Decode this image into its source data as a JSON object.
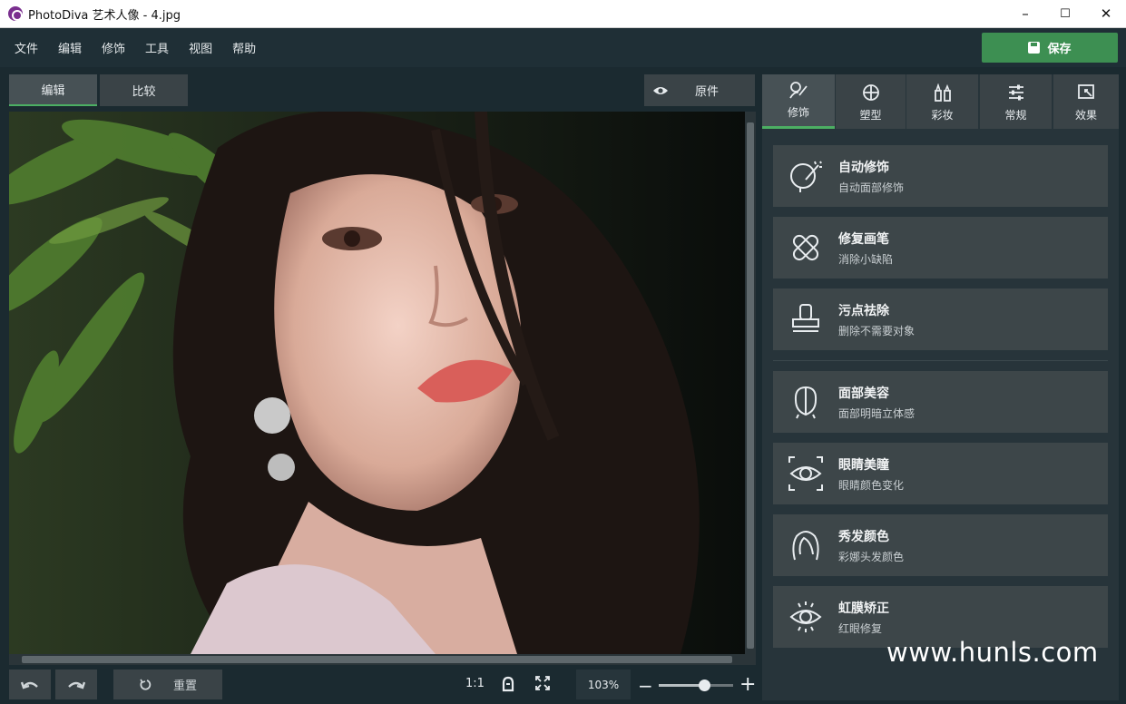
{
  "window": {
    "title": "PhotoDiva 艺术人像 - 4.jpg",
    "minimize": "–",
    "maximize": "☐",
    "close": "✕"
  },
  "menu": {
    "items": [
      "文件",
      "编辑",
      "修饰",
      "工具",
      "视图",
      "帮助"
    ],
    "save_label": "保存"
  },
  "view_tabs": {
    "edit": "编辑",
    "compare": "比较",
    "original": "原件"
  },
  "tool_tabs": [
    {
      "label": "修饰",
      "icon": "retouch-icon",
      "active": true
    },
    {
      "label": "塑型",
      "icon": "reshape-icon",
      "active": false
    },
    {
      "label": "彩妆",
      "icon": "makeup-icon",
      "active": false
    },
    {
      "label": "常规",
      "icon": "sliders-icon",
      "active": false
    },
    {
      "label": "效果",
      "icon": "effects-icon",
      "active": false
    }
  ],
  "tools": [
    {
      "title": "自动修饰",
      "subtitle": "自动面部修饰",
      "icon": "auto-retouch-icon"
    },
    {
      "title": "修复画笔",
      "subtitle": "消除小缺陷",
      "icon": "bandage-icon"
    },
    {
      "title": "污点祛除",
      "subtitle": "删除不需要对象",
      "icon": "stamp-icon"
    },
    {
      "title": "面部美容",
      "subtitle": "面部明暗立体感",
      "icon": "face-contour-icon"
    },
    {
      "title": "眼睛美瞳",
      "subtitle": "眼睛颜色变化",
      "icon": "eye-focus-icon"
    },
    {
      "title": "秀发颜色",
      "subtitle": "彩娜头发颜色",
      "icon": "hair-icon"
    },
    {
      "title": "虹膜矫正",
      "subtitle": "红眼修复",
      "icon": "iris-icon"
    }
  ],
  "bottom": {
    "reset_label": "重置",
    "ratio_label": "1:1",
    "zoom_value": "103%",
    "zoom_level": 0.61
  },
  "watermark": "www.hunls.com",
  "colors": {
    "accent": "#4caf63",
    "save": "#3d8f52"
  }
}
